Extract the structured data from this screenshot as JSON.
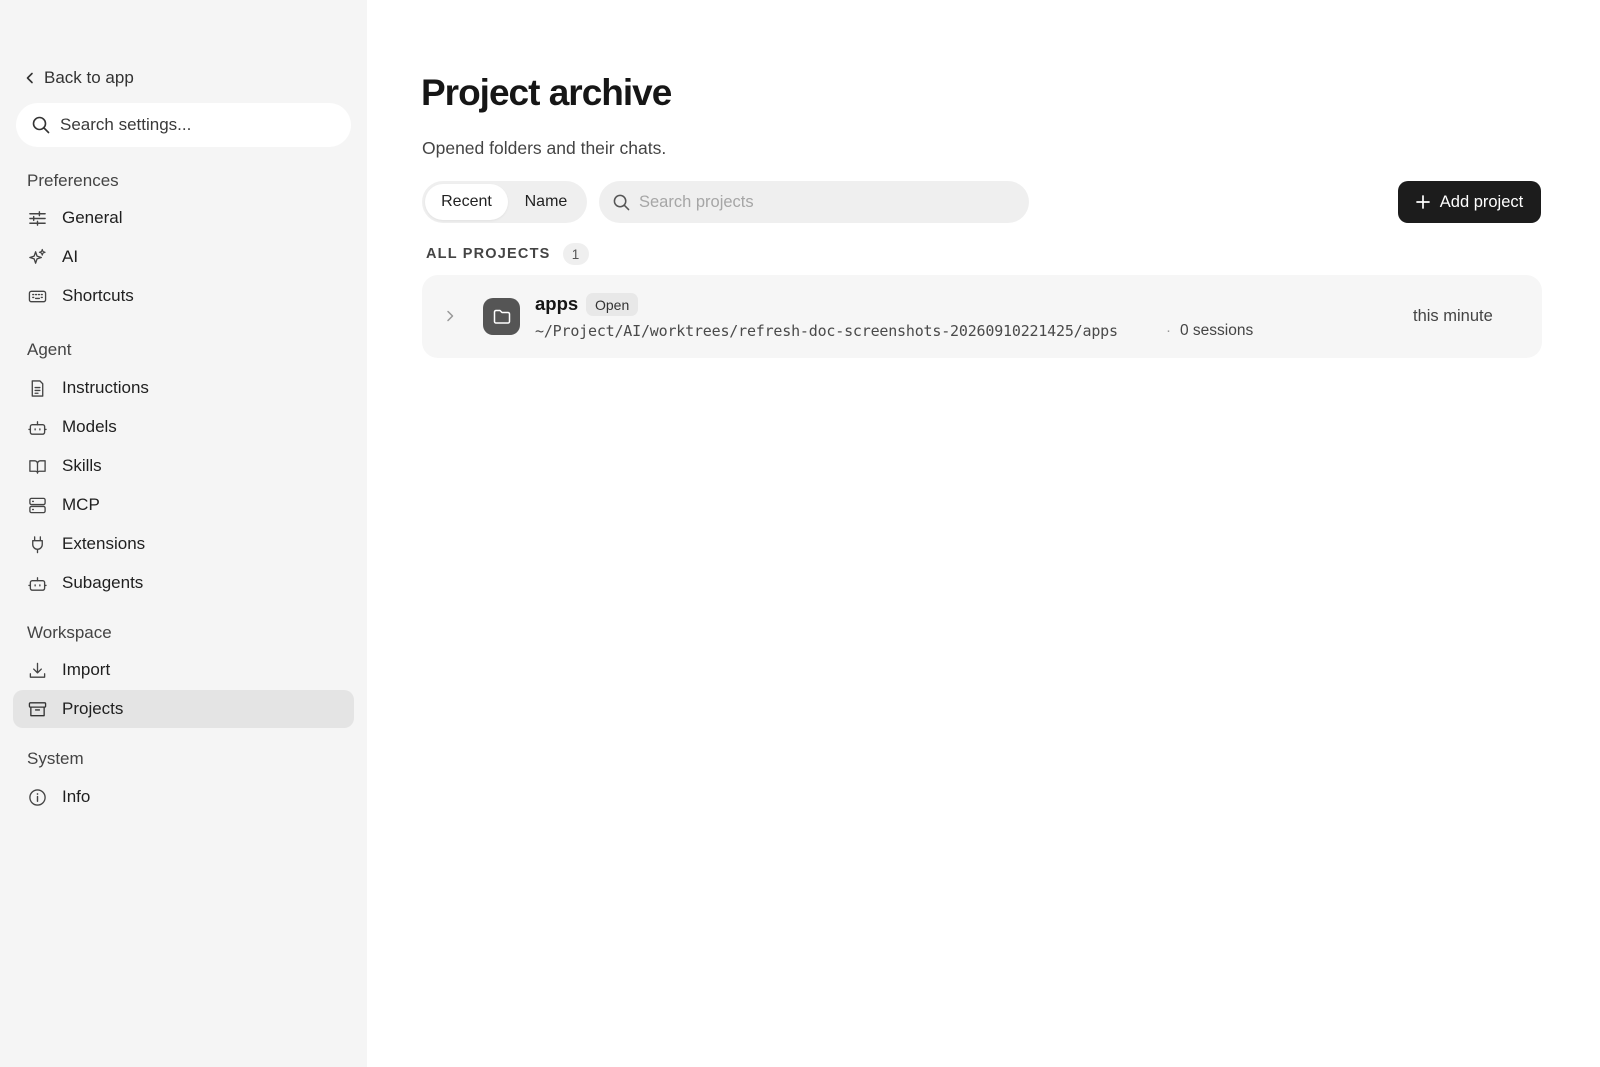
{
  "sidebar": {
    "back_label": "Back to app",
    "search_placeholder": "Search settings...",
    "sections": {
      "preferences": "Preferences",
      "agent": "Agent",
      "workspace": "Workspace",
      "system": "System"
    },
    "items": {
      "general": "General",
      "ai": "AI",
      "shortcuts": "Shortcuts",
      "instructions": "Instructions",
      "models": "Models",
      "skills": "Skills",
      "mcp": "MCP",
      "extensions": "Extensions",
      "subagents": "Subagents",
      "import": "Import",
      "projects": "Projects",
      "info": "Info"
    },
    "active_item": "Projects"
  },
  "main": {
    "title": "Project archive",
    "subtitle": "Opened folders and their chats.",
    "sort_tabs": [
      "Recent",
      "Name"
    ],
    "sort_selected": "Recent",
    "search_placeholder": "Search projects",
    "add_button_label": "Add project",
    "list_header": "ALL PROJECTS",
    "count": "1",
    "projects": [
      {
        "name": "apps",
        "status": "Open",
        "path": "~/Project/AI/worktrees/refresh-doc-screenshots-20260910221425/apps",
        "separator": "·",
        "sessions": "0 sessions",
        "updated": "this minute"
      }
    ]
  }
}
